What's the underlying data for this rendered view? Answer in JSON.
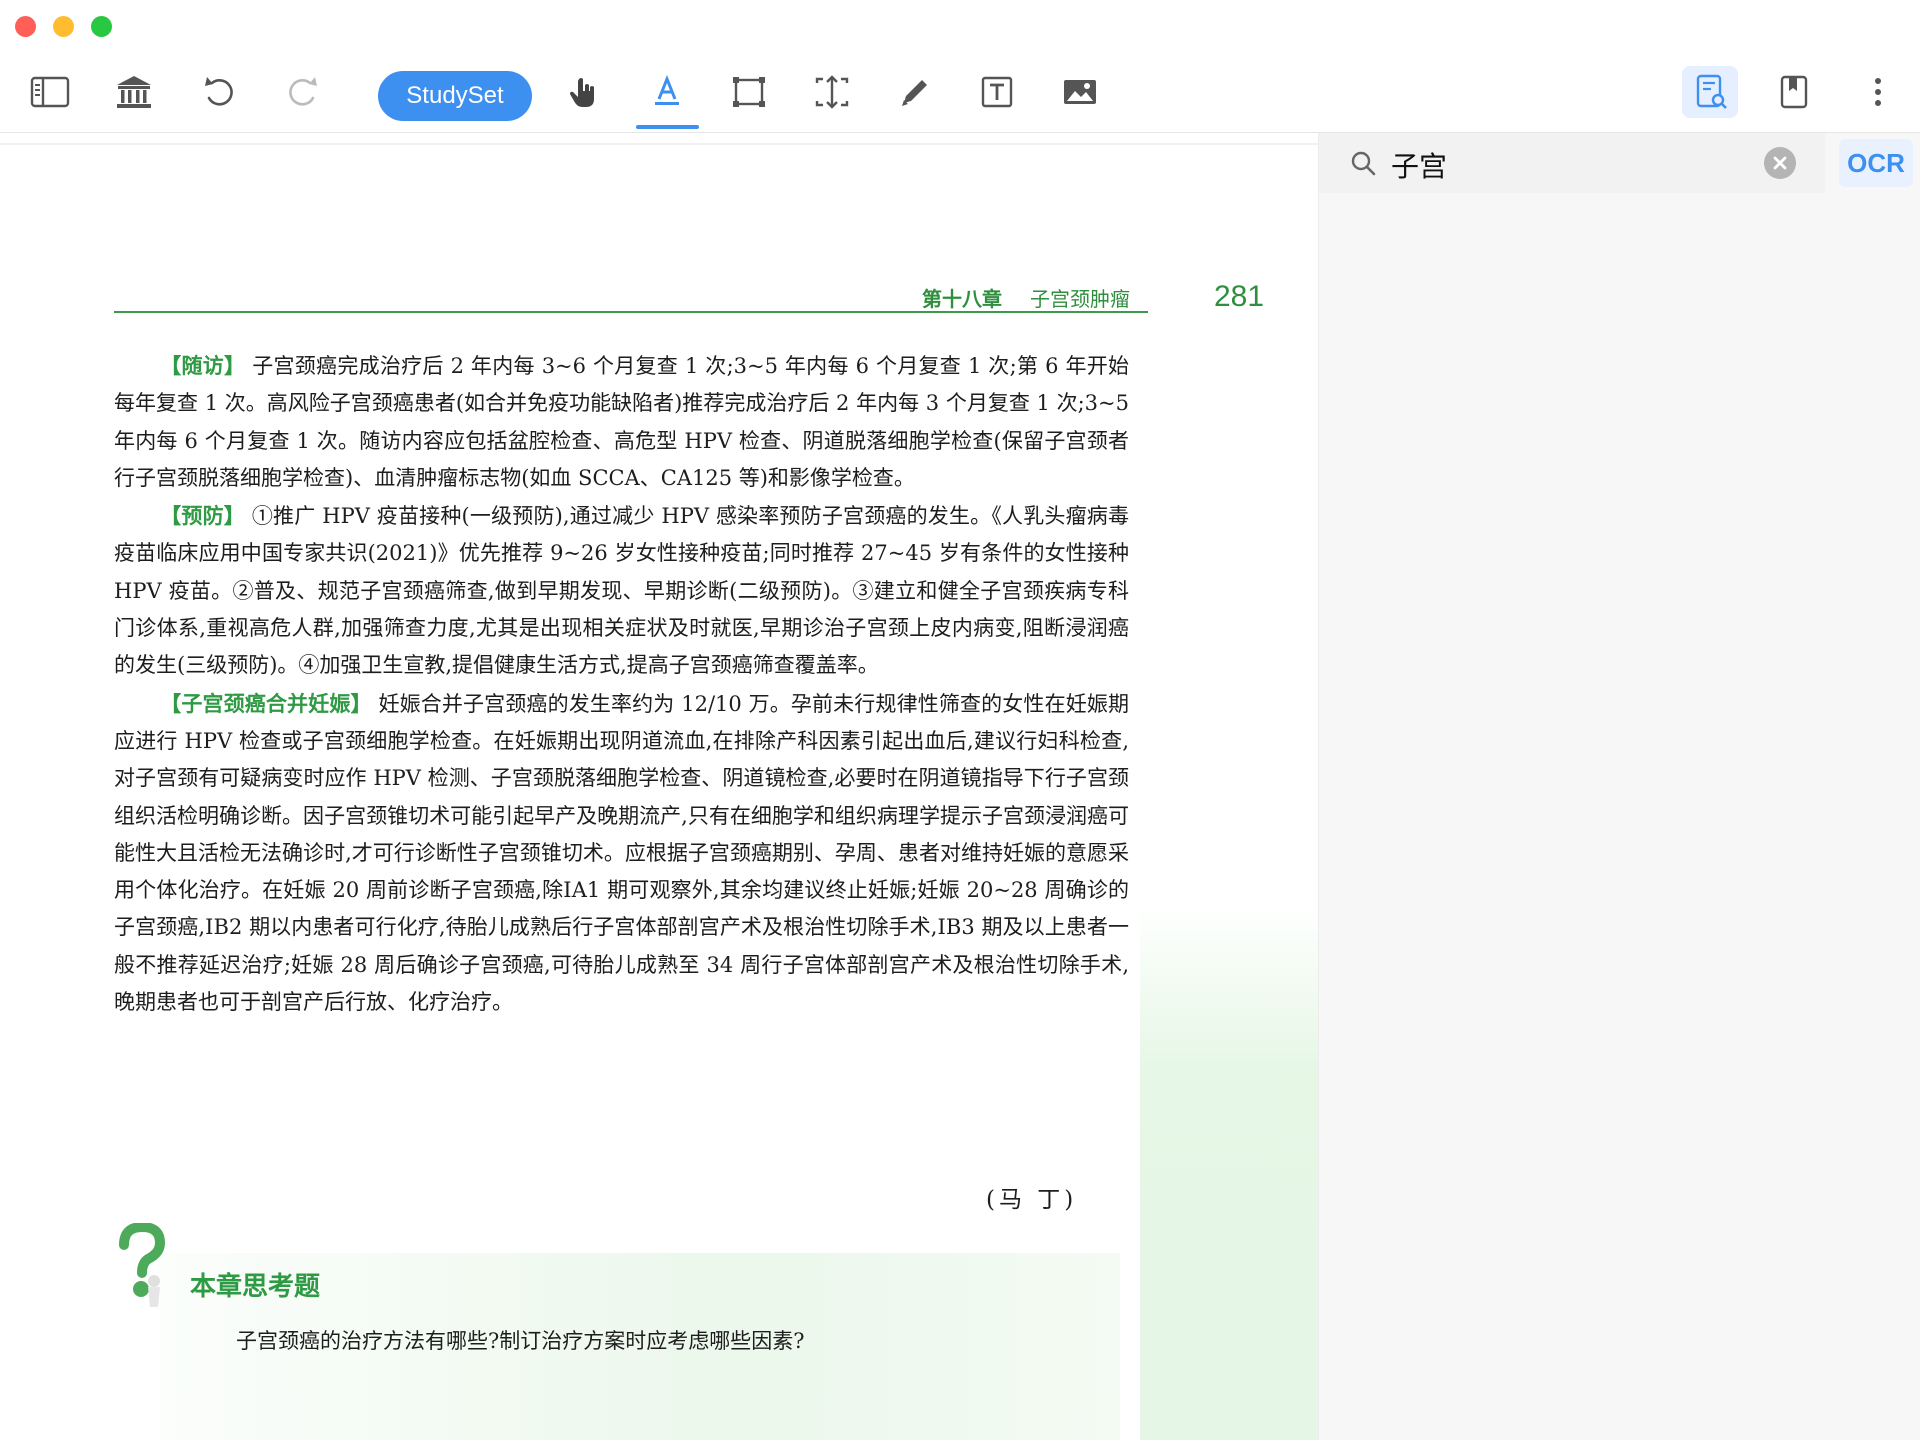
{
  "toolbar": {
    "studyset_label": "StudySet",
    "tools": [
      "sidebar-toggle",
      "library",
      "undo",
      "redo",
      "hand",
      "text-highlight",
      "area-select",
      "crop",
      "pen",
      "text-box",
      "image"
    ],
    "right_tools": [
      "search-document",
      "bookmark",
      "more-options"
    ],
    "active_tool": "text-highlight",
    "accent_color": "#3d8ff0"
  },
  "page": {
    "chapter_number": "第十八章",
    "chapter_title": "子宫颈肿瘤",
    "page_number": "281",
    "paragraphs": [
      {
        "tag": "【随访】",
        "text": "子宫颈癌完成治疗后 2 年内每 3~6 个月复查 1 次;3~5 年内每 6 个月复查 1 次;第 6 年开始每年复查 1 次。高风险子宫颈癌患者(如合并免疫功能缺陷者)推荐完成治疗后 2 年内每 3 个月复查 1 次;3~5 年内每 6 个月复查 1 次。随访内容应包括盆腔检查、高危型 HPV 检查、阴道脱落细胞学检查(保留子宫颈者行子宫颈脱落细胞学检查)、血清肿瘤标志物(如血 SCCA、CA125 等)和影像学检查。"
      },
      {
        "tag": "【预防】",
        "text": "①推广 HPV 疫苗接种(一级预防),通过减少 HPV 感染率预防子宫颈癌的发生。《人乳头瘤病毒疫苗临床应用中国专家共识(2021)》优先推荐 9~26 岁女性接种疫苗;同时推荐 27~45 岁有条件的女性接种 HPV 疫苗。②普及、规范子宫颈癌筛查,做到早期发现、早期诊断(二级预防)。③建立和健全子宫颈疾病专科门诊体系,重视高危人群,加强筛查力度,尤其是出现相关症状及时就医,早期诊治子宫颈上皮内病变,阻断浸润癌的发生(三级预防)。④加强卫生宣教,提倡健康生活方式,提高子宫颈癌筛查覆盖率。"
      },
      {
        "tag": "【子宫颈癌合并妊娠】",
        "text": "妊娠合并子宫颈癌的发生率约为 12/10 万。孕前未行规律性筛查的女性在妊娠期应进行 HPV 检查或子宫颈细胞学检查。在妊娠期出现阴道流血,在排除产科因素引起出血后,建议行妇科检查,对子宫颈有可疑病变时应作 HPV 检测、子宫颈脱落细胞学检查、阴道镜检查,必要时在阴道镜指导下行子宫颈组织活检明确诊断。因子宫颈锥切术可能引起早产及晚期流产,只有在细胞学和组织病理学提示子宫颈浸润癌可能性大且活检无法确诊时,才可行诊断性子宫颈锥切术。应根据子宫颈癌期别、孕周、患者对维持妊娠的意愿采用个体化治疗。在妊娠 20 周前诊断子宫颈癌,除ⅠA1 期可观察外,其余均建议终止妊娠;妊娠 20~28 周确诊的子宫颈癌,ⅠB2 期以内患者可行化疗,待胎儿成熟后行子宫体部剖宫产术及根治性切除手术,ⅠB3 期及以上患者一般不推荐延迟治疗;妊娠 28 周后确诊子宫颈癌,可待胎儿成熟至 34 周行子宫体部剖宫产术及根治性切除手术,晚期患者也可于剖宫产后行放、化疗治疗。"
      }
    ],
    "author": "(马 丁)",
    "thinking_title": "本章思考题",
    "thinking_question": "子宫颈癌的治疗方法有哪些?制订治疗方案时应考虑哪些因素?"
  },
  "sidebar": {
    "search_value": "子宫",
    "ocr_label": "OCR"
  },
  "colors": {
    "green_text": "#2f9a44",
    "accent": "#3d8ff0"
  }
}
